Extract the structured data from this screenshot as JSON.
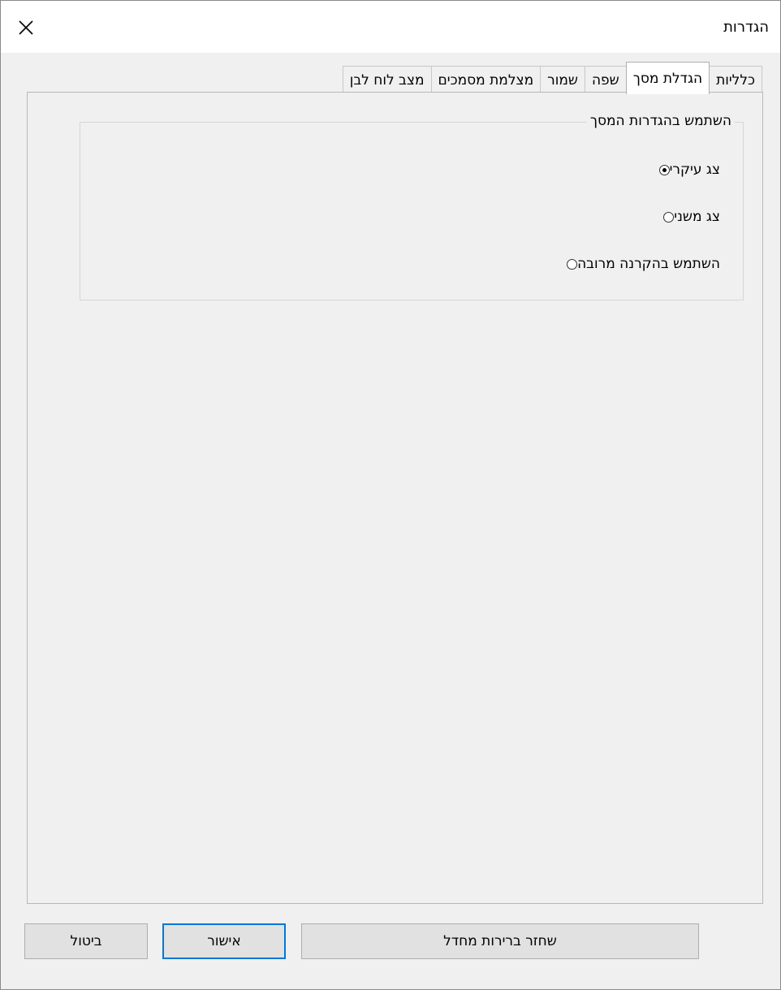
{
  "window": {
    "title": "הגדרות"
  },
  "tabs": [
    {
      "label": "כלליות",
      "active": false
    },
    {
      "label": "הגדלת מסך",
      "active": true
    },
    {
      "label": "שפה",
      "active": false
    },
    {
      "label": "שמור",
      "active": false
    },
    {
      "label": "מצלמת מסמכים",
      "active": false
    },
    {
      "label": "מצב לוח לבן",
      "active": false
    }
  ],
  "display_group": {
    "legend": "השתמש בהגדרות המסך",
    "options": [
      {
        "label": "צג עיקרי",
        "selected": true
      },
      {
        "label": "צג משני",
        "selected": false
      },
      {
        "label": "השתמש בהקרנה מרובה",
        "selected": false
      }
    ]
  },
  "buttons": {
    "restore_defaults": "שחזר ברירות מחדל",
    "ok": "אישור",
    "cancel": "ביטול"
  },
  "icons": {
    "close": "close-icon"
  },
  "colors": {
    "accent": "#0078d7",
    "panel_bg": "#f0f0f0",
    "titlebar_bg": "#ffffff"
  }
}
